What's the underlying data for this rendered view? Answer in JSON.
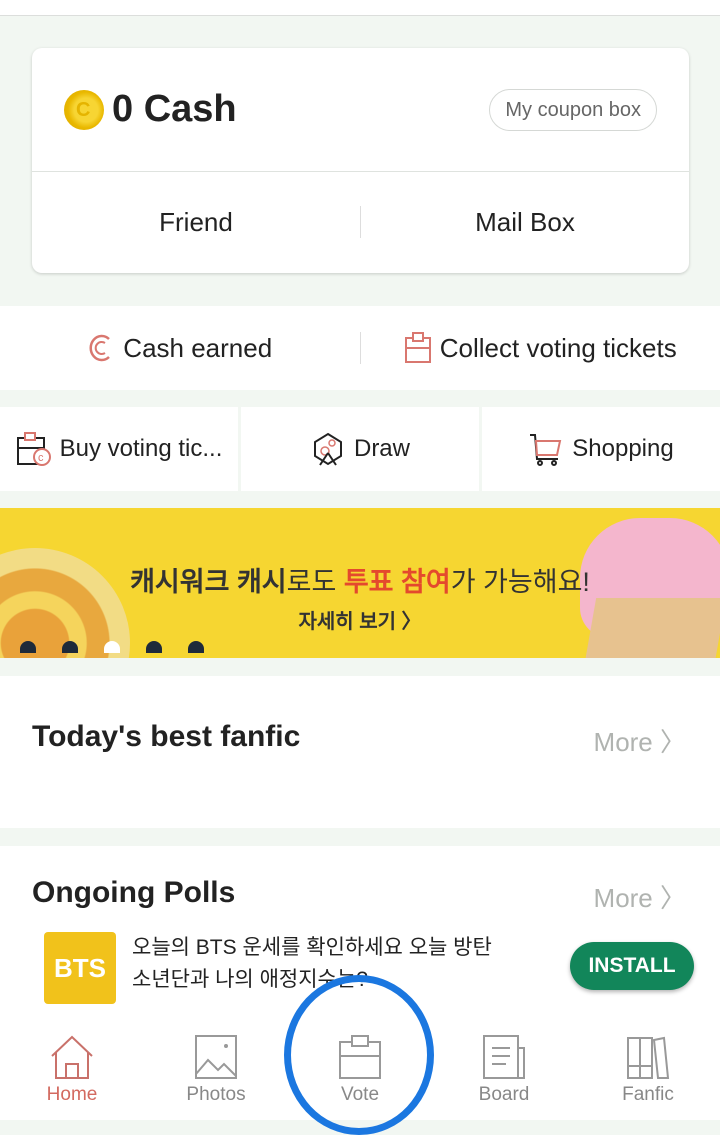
{
  "cash": {
    "amount": "0 Cash",
    "coupon_button": "My coupon box",
    "links": [
      "Friend",
      "Mail Box"
    ]
  },
  "earn": {
    "items": [
      {
        "icon": "cash-icon",
        "label": "Cash earned"
      },
      {
        "icon": "ticket-icon",
        "label": "Collect voting tickets"
      }
    ]
  },
  "tiles": [
    {
      "icon": "buy-ticket-icon",
      "label": "Buy voting tic..."
    },
    {
      "icon": "draw-icon",
      "label": "Draw"
    },
    {
      "icon": "cart-icon",
      "label": "Shopping"
    }
  ],
  "banner": {
    "title_part1": "캐시워크 캐시",
    "title_part2": "로도 ",
    "title_highlight": "투표 참여",
    "title_part3": "가 가능해요!",
    "subtitle": "자세히 보기 〉",
    "slide_count": 5,
    "active_slide": 3
  },
  "sections": {
    "fanfic": {
      "title": "Today's best fanfic",
      "more": "More 〉"
    },
    "polls": {
      "title": "Ongoing Polls",
      "more": "More 〉"
    }
  },
  "ad": {
    "icon_text": "BTS",
    "text": "오늘의 BTS 운세를 확인하세요 오늘 방탄소년단과 나의 애정지수는?",
    "button": "INSTALL"
  },
  "nav": {
    "items": [
      {
        "icon": "home-icon",
        "label": "Home",
        "active": true
      },
      {
        "icon": "photos-icon",
        "label": "Photos",
        "active": false
      },
      {
        "icon": "vote-icon",
        "label": "Vote",
        "active": false
      },
      {
        "icon": "board-icon",
        "label": "Board",
        "active": false
      },
      {
        "icon": "fanfic-icon",
        "label": "Fanfic",
        "active": false
      }
    ]
  },
  "colors": {
    "accent_red": "#d36a60",
    "install_green": "#12865a",
    "banner_yellow": "#f6d631",
    "annotation_blue": "#1b77e0"
  }
}
